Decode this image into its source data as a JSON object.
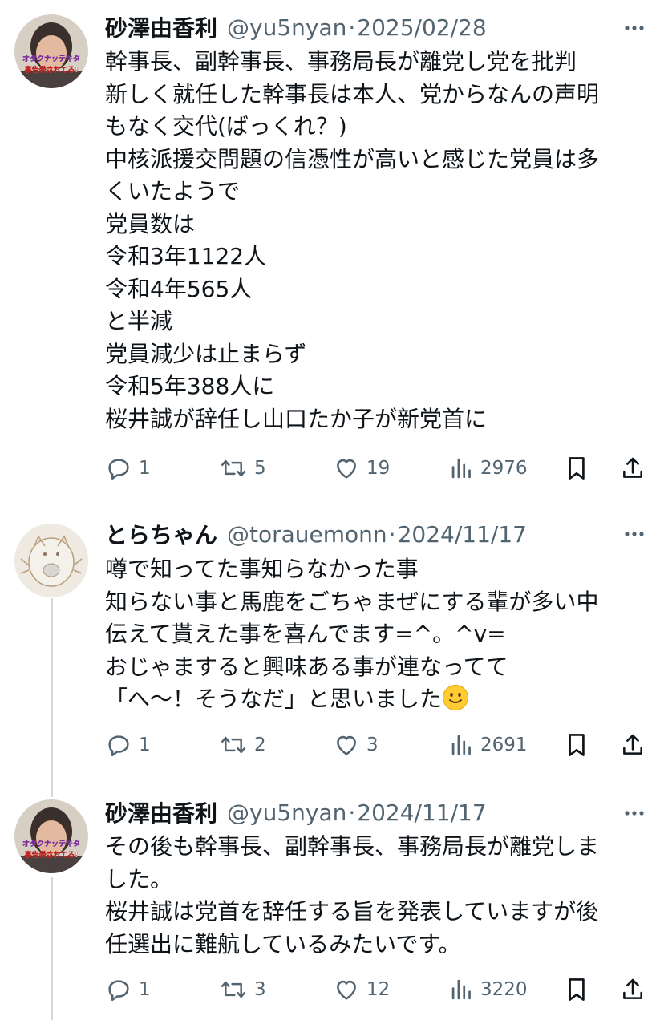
{
  "tweets": [
    {
      "name": "砂澤由香利",
      "handle": "@yu5nyan",
      "dot": "·",
      "date": "2025/02/28",
      "avatar_caption_1": "オタクナッテキタ",
      "avatar_caption_2": "事告発されてる!",
      "text": "幹事長、副幹事長、事務局長が離党し党を批判\n新しく就任した幹事長は本人、党からなんの声明\nもなく交代(ばっくれ？)\n中核派援交問題の信憑性が高いと感じた党員は多\nくいたようで\n党員数は\n令和3年1122人\n令和4年565人\nと半減\n党員減少は止まらず\n令和5年388人に\n桜井誠が辞任し山口たか子が新党首に",
      "replies": "1",
      "retweets": "5",
      "likes": "19",
      "views": "2976"
    },
    {
      "name": "とらちゃん",
      "handle": "@torauemonn",
      "dot": "·",
      "date": "2024/11/17",
      "text": "噂で知ってた事知らなかった事\n知らない事と馬鹿をごちゃまぜにする輩が多い中\n伝えて貰えた事を喜んでます=^。^v=\nおじゃますると興味ある事が連なってて\n「へ～！そうなだ」と思いました",
      "replies": "1",
      "retweets": "2",
      "likes": "3",
      "views": "2691"
    },
    {
      "name": "砂澤由香利",
      "handle": "@yu5nyan",
      "dot": "·",
      "date": "2024/11/17",
      "avatar_caption_1": "オタクナッテキタ",
      "avatar_caption_2": "事告発されてる!",
      "text": "その後も幹事長、副幹事長、事務局長が離党しま\nした。\n桜井誠は党首を辞任する旨を発表していますが後\n任選出に難航しているみたいです。",
      "replies": "1",
      "retweets": "3",
      "likes": "12",
      "views": "3220"
    }
  ],
  "colors": {
    "text": "#0f1419",
    "secondary": "#536471",
    "divider": "#e1e5e8",
    "thread_line": "#cfd9de"
  },
  "icons": [
    "reply-icon",
    "retweet-icon",
    "like-icon",
    "views-icon",
    "bookmark-icon",
    "share-icon",
    "more-icon",
    "smile-emoji"
  ]
}
